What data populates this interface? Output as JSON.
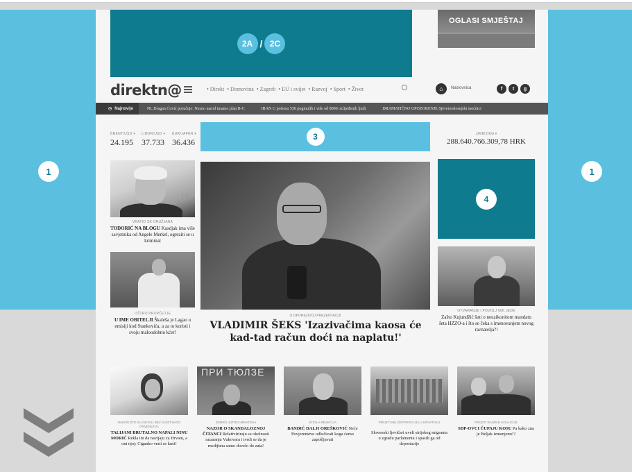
{
  "layout_labels": {
    "side": "1",
    "top_a": "2A",
    "top_sep": "/",
    "top_c": "2C",
    "center": "3",
    "right": "4"
  },
  "colors": {
    "ad_light": "#5bc0e0",
    "ad_dark": "#0e7b8f",
    "background": "#d9d9d9"
  },
  "ad_oglasi": {
    "text": "OGLASI SMJEŠTAJ"
  },
  "header": {
    "logo": "direktn@",
    "nav": [
      "• Direkt",
      "• Domovina",
      "• Zagreb",
      "• EU i svijet",
      "• Razvoj",
      "• Sport",
      "• Život"
    ],
    "home_label": "Naslovnica",
    "social": [
      "f",
      "t",
      "g"
    ]
  },
  "ticker": {
    "label": "Najnovije",
    "items": [
      "NL Dragan Ćović poručuje: Nezno narod imamo plan B-C",
      "IRAN U potresu 530 poginulih i više od 8000 ozlijeđenih ljudi",
      "DRAMATIČNO UPOZORENJE Sjevernokorejski moćnici"
    ]
  },
  "currency": [
    {
      "label": "BRENT/USD ▾",
      "value": "24.195"
    },
    {
      "label": "LIBOR/USD ▾",
      "value": "37.733"
    },
    {
      "label": "EUR/JAPAN ▾",
      "value": "36.436"
    }
  ],
  "debt": {
    "label": "JAVNI DUG ▾",
    "value": "288.640.766.309,78 HRK"
  },
  "left_stories": [
    {
      "kicker": "VRATIO SE ORUŽJANA",
      "title_bold": "TODORIĆ NA BLOGU",
      "title_rest": " Kasdjak ima više savjetnika od Angele Merkel, ogreziti se u kriminal"
    },
    {
      "kicker": "OŠTRO PROPČETJE",
      "title_bold": "U IME OBITELJI",
      "title_rest": " Škaleša je Lagao u emisiji kod Stankovića, a za to koristi i svoju maloodobnu kćer!"
    }
  ],
  "main_story": {
    "kicker": "O OPOREZIVOJ PREZENTACIJI",
    "title": "VLADIMIR ŠEKS 'Izazivačima kaosa će kad-tad račun doći na naplatu!'"
  },
  "right_story": {
    "kicker": "OTVARANJE I POVOLJ 60K JEDE",
    "title": "Zašto Kujundžić šuti o neuzikonitom mandatu šeta HZZO-a i što se čeka s imenovanjem novog ravnatelja?!"
  },
  "bottom_stories": [
    {
      "kicker": "NAKON ŠTO SU OSTALI BEZ SVJETSKOG PRVENSTVA",
      "title_bold": "TALIJANI BRUTALNO NAPALI NINU MORIĆ",
      "title_rest": " Rekla im da navijaju za Hrvatu, a oni njoj: Ciganko vrati se kući!"
    },
    {
      "kicker": "DOBRO JUTRO HRVATSKA",
      "title_bold": "NAZOR O SKANDALOZNOJ ČITANCI",
      "title_rest": " Relativiziraju se okolnosti razaranja Vukovara i tvrdi se da je medijima samo dovelo do zata!"
    },
    {
      "kicker": "STIGLA REAKCIJA",
      "title_bold": "BANDIĆ DALJI OREŠKOVIĆ",
      "title_rest": " Neće Povjerenstvo odlučivati koga ćemo zapošljavati"
    },
    {
      "kicker": "PRIJETI MU DEPORTACIJA U HRVATSKU",
      "title_bold": "",
      "title_rest": "Slovenski ljevičari uveli sirijskog migranta u zgradu parlamenta i spasili ga od deportacije"
    },
    {
      "kicker": "PRIJETI RASPAD KOALICIJE",
      "title_bold": "SDP-OVCI ČUPAJU KOSU",
      "title_rest": " Pa kako zna je Beljak izmenjeno!?"
    }
  ],
  "thumb_text": "ПРИ ТЮЛЗЕ"
}
